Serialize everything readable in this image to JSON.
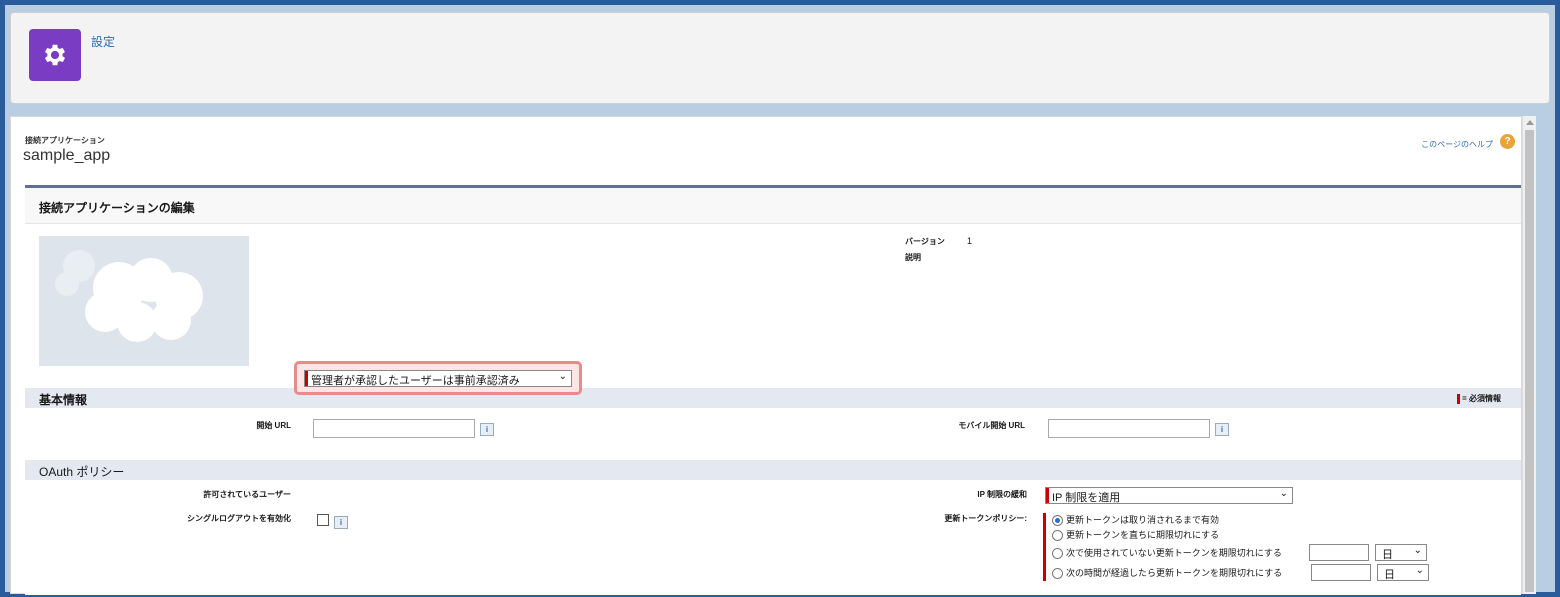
{
  "header": {
    "title": "設定",
    "icon": "gear-icon"
  },
  "app": {
    "breadcrumb": "接続アプリケーション",
    "name": "sample_app",
    "help_link": "このページのヘルプ",
    "help_icon": "?"
  },
  "edit": {
    "title": "接続アプリケーションの編集",
    "version_label": "バージョン",
    "version_value": "1",
    "description_label": "説明"
  },
  "basic": {
    "title": "基本情報",
    "required_legend": "= 必須情報",
    "start_url_label": "開始 URL",
    "mobile_start_url_label": "モバイル開始 URL",
    "start_url_value": "",
    "mobile_start_url_value": ""
  },
  "oauth": {
    "title": "OAuth ポリシー",
    "permitted_users_label": "許可されているユーザー",
    "permitted_users_value": "管理者が承認したユーザーは事前承認済み",
    "single_logout_label": "シングルログアウトを有効化",
    "single_logout_checked": false,
    "ip_relax_label": "IP 制限の緩和",
    "ip_relax_value": "IP 制限を適用",
    "refresh_policy_label": "更新トークンポリシー:",
    "refresh_options": [
      "更新トークンは取り消されるまで有効",
      "更新トークンを直ちに期限切れにする",
      "次で使用されていない更新トークンを期限切れにする",
      "次の時間が経過したら更新トークンを期限切れにする"
    ],
    "refresh_selected_index": 0,
    "unit_value_1": "日",
    "unit_value_2": "日",
    "info_glyph": "i",
    "chevron": "⌄"
  }
}
